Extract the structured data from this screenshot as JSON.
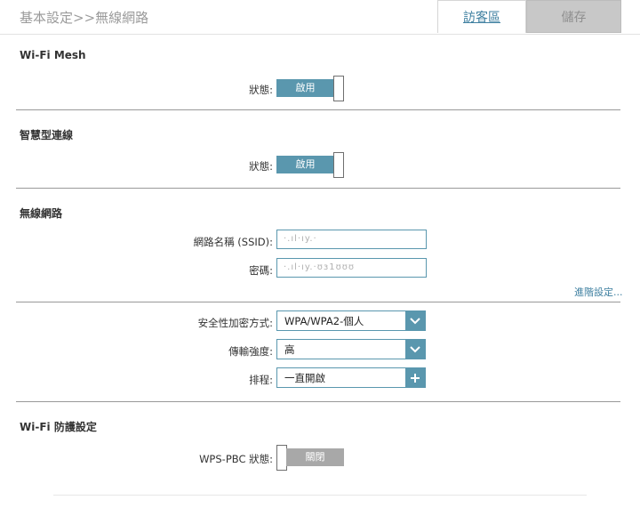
{
  "header": {
    "breadcrumb": "基本設定>>無線網路",
    "guest_tab": "訪客區",
    "save_button": "儲存"
  },
  "wifi_mesh": {
    "title": "Wi-Fi Mesh",
    "status_label": "狀態:",
    "toggle_label": "啟用",
    "enabled": true
  },
  "smart_connect": {
    "title": "智慧型連線",
    "status_label": "狀態:",
    "toggle_label": "啟用",
    "enabled": true
  },
  "wireless": {
    "title": "無線網路",
    "ssid_label": "網路名稱 (SSID):",
    "ssid_value": "·.ıl·ıy.·",
    "password_label": "密碼:",
    "password_value": "·.ıl·ıy.·ʊɜ1ʊʊʊ",
    "advanced_link": "進階設定...",
    "security_label": "安全性加密方式:",
    "security_value": "WPA/WPA2-個人",
    "power_label": "傳輸強度:",
    "power_value": "高",
    "schedule_label": "排程:",
    "schedule_value": "一直開啟"
  },
  "wps": {
    "title": "Wi-Fi 防護設定",
    "status_label": "WPS-PBC 狀態:",
    "toggle_label": "關閉",
    "enabled": false
  },
  "colors": {
    "accent": "#5a97ae",
    "link": "#3e7fa0",
    "disabled": "#a8a8a8"
  }
}
